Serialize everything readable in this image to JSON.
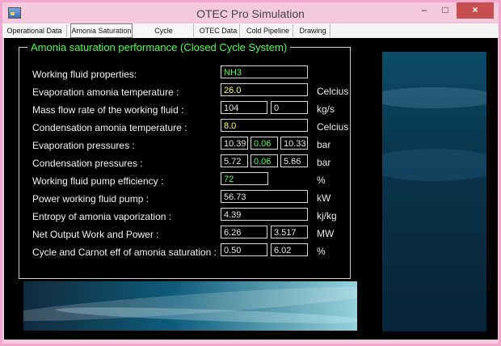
{
  "window": {
    "title": "OTEC Pro Simulation",
    "controls": {
      "minimize": "–",
      "maximize": "□",
      "close": "×"
    }
  },
  "tabs": [
    {
      "label": "Operational Data",
      "active": false
    },
    {
      "label": "Amonia Saturation",
      "active": true
    },
    {
      "label": "Cycle Performance",
      "active": false
    },
    {
      "label": "OTEC Data",
      "active": false
    },
    {
      "label": "Cold Pipeline",
      "active": false
    },
    {
      "label": "Drawing",
      "active": false
    }
  ],
  "panel": {
    "title": "Amonia saturation performance (Closed Cycle System)",
    "rows": [
      {
        "label": "Working fluid properties:",
        "fields": [
          "NH3"
        ],
        "unit": ""
      },
      {
        "label": "Evaporation amonia temperature :",
        "fields": [
          "26.0"
        ],
        "unit": "Celcius"
      },
      {
        "label": "Mass flow rate of the working fluid :",
        "fields": [
          "104",
          "0"
        ],
        "unit": "kg/s"
      },
      {
        "label": "Condensation amonia temperature :",
        "fields": [
          "8.0"
        ],
        "unit": "Celcius"
      },
      {
        "label": "Evaporation pressures :",
        "fields": [
          "10.39",
          "0.06",
          "10.33"
        ],
        "unit": "bar"
      },
      {
        "label": "Condensation pressures :",
        "fields": [
          "5.72",
          "0.06",
          "5.66"
        ],
        "unit": "bar"
      },
      {
        "label": "Working fluid pump efficiency :",
        "fields": [
          "72"
        ],
        "unit": "%"
      },
      {
        "label": "Power working fluid pump :",
        "fields": [
          "56.73"
        ],
        "unit": "kW"
      },
      {
        "label": "Entropy of amonia vaporization :",
        "fields": [
          "4.39"
        ],
        "unit": "kj/kg"
      },
      {
        "label": "Net Output Work and Power :",
        "fields": [
          "6.26",
          "3.517"
        ],
        "unit": "MW"
      },
      {
        "label": "Cycle and Carnot eff of amonia saturation :",
        "fields": [
          "0.50",
          "6.02"
        ],
        "unit": "%"
      }
    ]
  },
  "colors": {
    "accent_green": "#4cff4c",
    "accent_yellow": "#ffff59",
    "window_frame": "#f4c9dd",
    "close_button": "#c74f4f"
  }
}
